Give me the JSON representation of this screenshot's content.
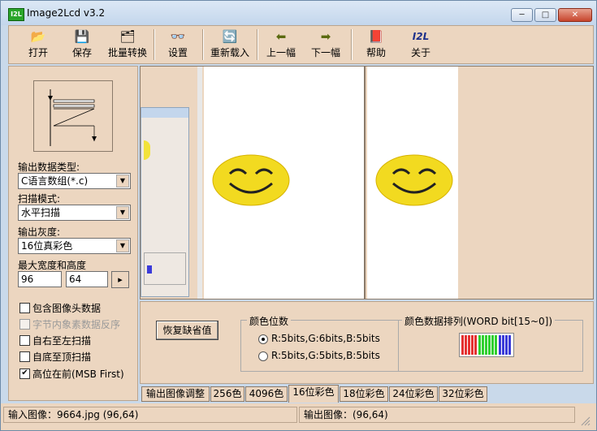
{
  "window": {
    "title": "Image2Lcd v3.2",
    "icon_text": "I2L"
  },
  "titlebar_buttons": {
    "minimize": "─",
    "maximize": "□",
    "close": "✕"
  },
  "toolbar": [
    {
      "label": "打开",
      "icon": "open-folder-icon",
      "glyph": "📂"
    },
    {
      "label": "保存",
      "icon": "floppy-disk-icon",
      "glyph": "💾"
    },
    {
      "label": "批量转换",
      "icon": "batch-disks-icon",
      "glyph": "🗂"
    },
    {
      "label": "设置",
      "icon": "glasses-icon",
      "glyph": "👓"
    },
    {
      "label": "重新载入",
      "icon": "reload-icon",
      "glyph": "🔄"
    },
    {
      "label": "上一幅",
      "icon": "arrow-left-icon",
      "glyph": "⬅"
    },
    {
      "label": "下一幅",
      "icon": "arrow-right-icon",
      "glyph": "➡"
    },
    {
      "label": "帮助",
      "icon": "help-book-icon",
      "glyph": "📕"
    },
    {
      "label": "关于",
      "icon": "i2l-logo-icon",
      "glyph": "I2L"
    }
  ],
  "left": {
    "output_type_label": "输出数据类型:",
    "output_type_value": "C语言数组(*.c)",
    "scan_mode_label": "扫描模式:",
    "scan_mode_value": "水平扫描",
    "gray_label": "输出灰度:",
    "gray_value": "16位真彩色",
    "size_label": "最大宽度和高度",
    "width": "96",
    "height": "64",
    "size_button": "▸",
    "checkboxes": [
      {
        "label": "包含图像头数据",
        "checked": false,
        "enabled": true
      },
      {
        "label": "字节内象素数据反序",
        "checked": false,
        "enabled": false
      },
      {
        "label": "自右至左扫描",
        "checked": false,
        "enabled": true
      },
      {
        "label": "自底至顶扫描",
        "checked": false,
        "enabled": true
      },
      {
        "label": "高位在前(MSB First)",
        "checked": true,
        "enabled": true
      }
    ]
  },
  "bottom": {
    "restore_button": "恢复缺省值",
    "color_bits_group": "颜色位数",
    "radio1": "R:5bits,G:6bits,B:5bits",
    "radio2": "R:5bits,G:5bits,B:5bits",
    "arrangement_group": "颜色数据排列(WORD bit[15~0])"
  },
  "tabs": [
    "输出图像调整",
    "256色",
    "4096色",
    "16位彩色",
    "18位彩色",
    "24位彩色",
    "32位彩色"
  ],
  "active_tab": "16位彩色",
  "status": {
    "input": "输入图像：9664.jpg (96,64)",
    "output": "输出图像：(96,64)"
  },
  "colors": {
    "panel": "#ecd6c0",
    "accent_green": "#2aa52a"
  }
}
